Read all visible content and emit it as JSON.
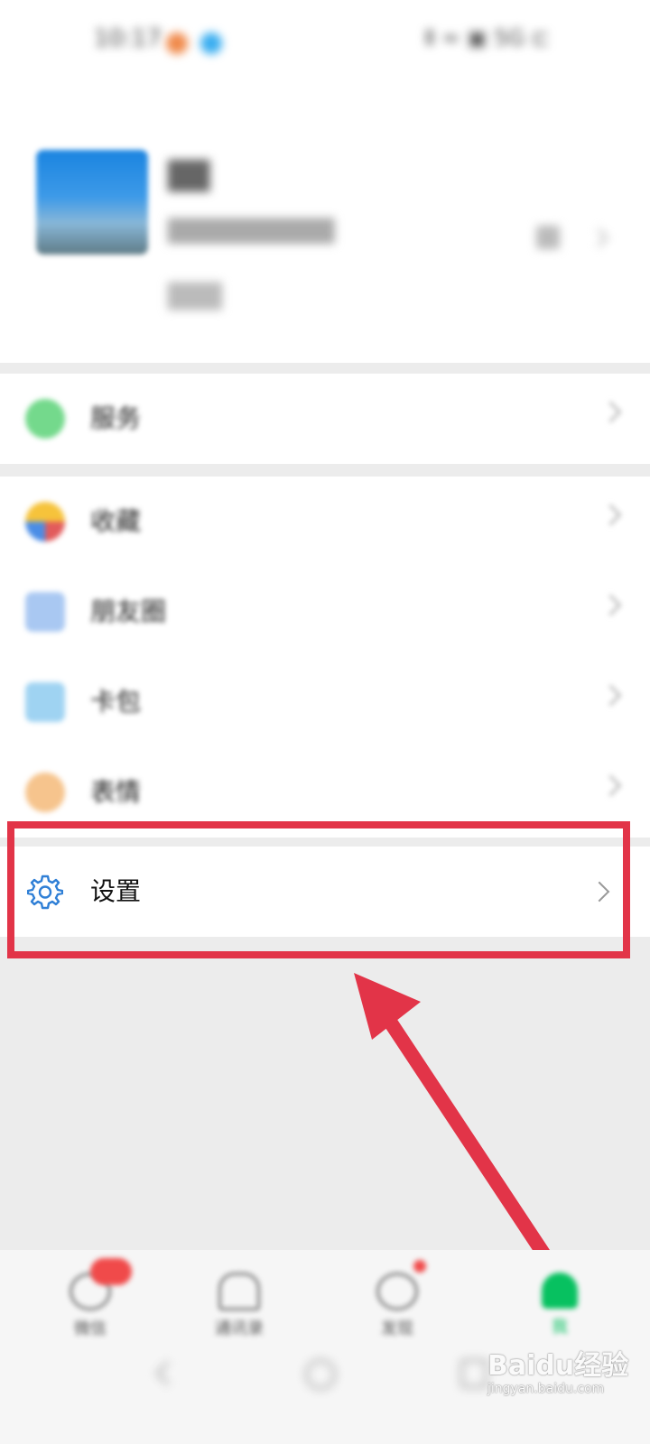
{
  "status_bar": {
    "time": "10:17",
    "right": "Ⅱ ≈ ▣ 5G ⊏"
  },
  "profile": {
    "name": "██",
    "account": "██████████",
    "status": "███"
  },
  "menu": {
    "services_label": "服务",
    "favorites_label": "收藏",
    "moments_label": "朋友圈",
    "cards_label": "卡包",
    "stickers_label": "表情",
    "settings_label": "设置"
  },
  "tabbar": {
    "tabs": [
      {
        "label": "微信"
      },
      {
        "label": "通讯录"
      },
      {
        "label": "发现"
      },
      {
        "label": "我"
      }
    ]
  },
  "watermark": {
    "brand": "Baidu经验",
    "url": "jingyan.baidu.com"
  },
  "colors": {
    "highlight_red": "#e23448",
    "accent_green": "#07c160",
    "settings_blue": "#2f7fd6"
  }
}
